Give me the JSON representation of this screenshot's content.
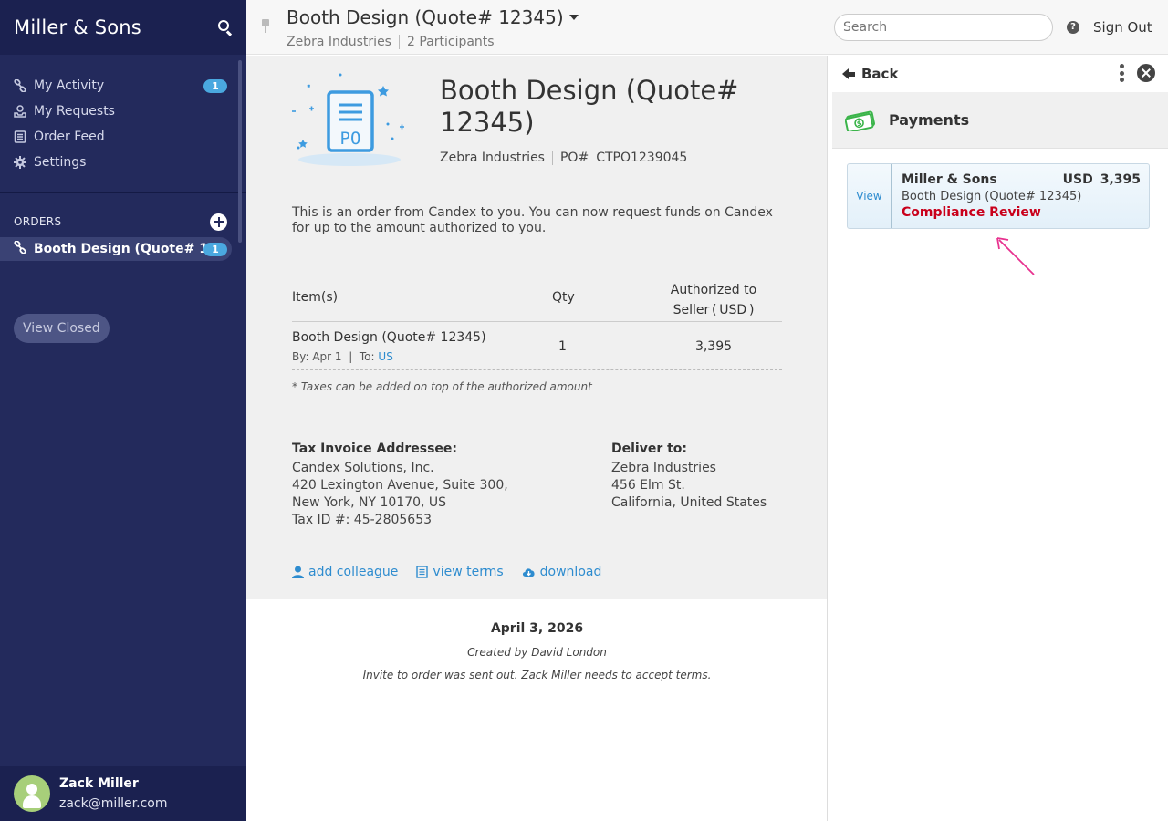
{
  "sidebar": {
    "title": "Miller & Sons",
    "nav": [
      {
        "label": "My Activity",
        "icon": "link-icon",
        "badge": "1"
      },
      {
        "label": "My Requests",
        "icon": "inbox-icon"
      },
      {
        "label": "Order Feed",
        "icon": "list-icon"
      },
      {
        "label": "Settings",
        "icon": "gear-icon"
      }
    ],
    "orders_heading": "ORDERS",
    "orders": [
      {
        "label": "Booth Design (Quote# 1...",
        "badge": "1"
      }
    ],
    "view_closed": "View Closed",
    "user": {
      "name": "Zack Miller",
      "email": "zack@miller.com"
    }
  },
  "topbar": {
    "title": "Booth Design (Quote# 12345)",
    "company": "Zebra Industries",
    "participants": "2  Participants",
    "search_placeholder": "Search",
    "sign_out": "Sign Out"
  },
  "po": {
    "illustration_text": "PO",
    "title": "Booth Design (Quote# 12345)",
    "company": "Zebra Industries",
    "po_label": "PO#",
    "po_number": "CTPO1239045",
    "description": "This is an order from Candex to you. You can now request funds on Candex for up to the amount authorized to you.",
    "table": {
      "col_items": "Item(s)",
      "col_qty": "Qty",
      "col_auth_line1": "Authorized to",
      "col_auth_line2": "Seller ( USD )",
      "rows": [
        {
          "item": "Booth Design (Quote# 12345)",
          "by_label": "By:",
          "by": "Apr 1",
          "to_label": "To:",
          "to": "US",
          "qty": "1",
          "amount": "3,395"
        }
      ]
    },
    "tax_note": "* Taxes can be added on top of the authorized amount",
    "invoice": {
      "heading": "Tax Invoice Addressee:",
      "lines": [
        "Candex Solutions, Inc.",
        "420 Lexington Avenue, Suite 300,",
        "New York, NY 10170, US",
        "Tax ID #: 45-2805653"
      ]
    },
    "deliver": {
      "heading": "Deliver to:",
      "lines": [
        "Zebra Industries",
        "456 Elm St.",
        "California, United States"
      ]
    },
    "actions": {
      "add_colleague": "add colleague",
      "view_terms": "view terms",
      "download": "download"
    }
  },
  "timeline": {
    "date": "April 3, 2026",
    "created": "Created by David London",
    "note": "Invite to order was sent out. Zack Miller needs to accept terms."
  },
  "rpanel": {
    "back": "Back",
    "section_title": "Payments",
    "payment": {
      "view": "View",
      "vendor": "Miller & Sons",
      "currency": "USD",
      "amount": "3,395",
      "description": "Booth Design (Quote# 12345)",
      "status": "Compliance Review"
    }
  },
  "colors": {
    "sidebar_bg": "#232a5c",
    "accent_blue": "#2e8ccf",
    "badge_blue": "#4aa8df",
    "status_red": "#c9001b",
    "annotation_pink": "#e8328f",
    "money_green": "#3bb44a"
  }
}
